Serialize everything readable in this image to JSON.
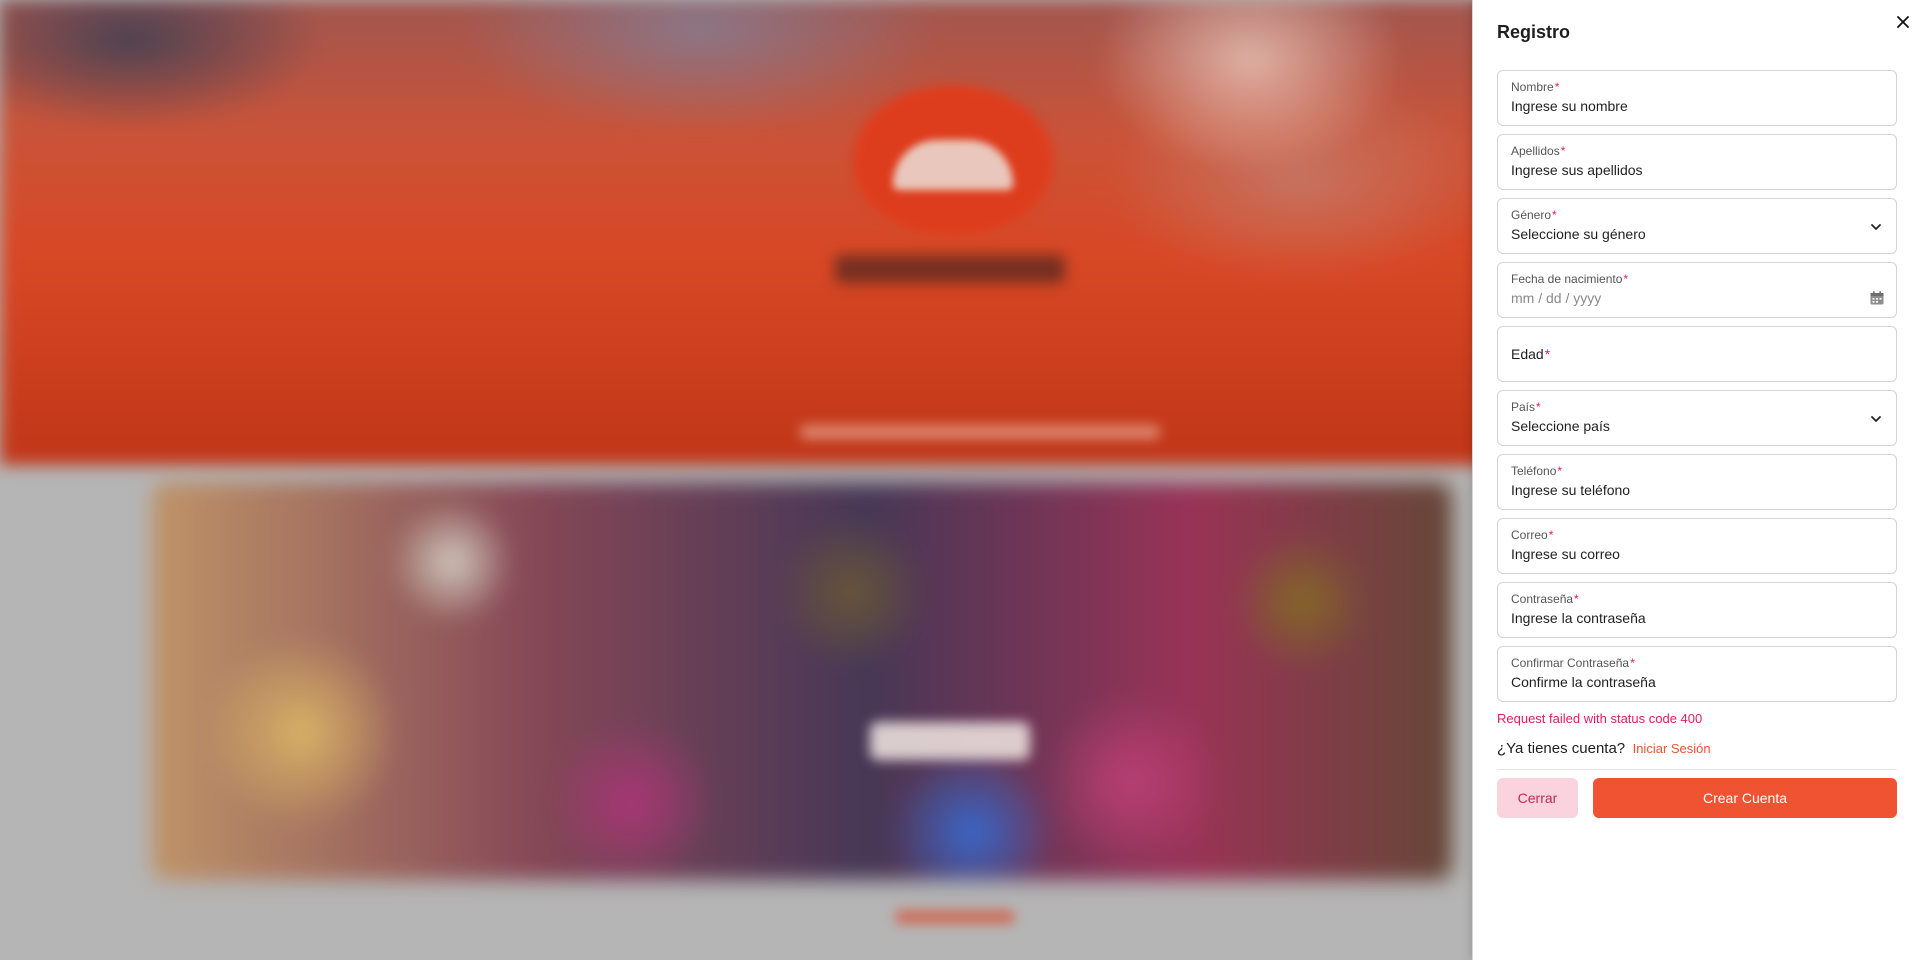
{
  "drawer": {
    "title": "Registro",
    "fields": [
      {
        "label": "Nombre",
        "value": "Ingrese su nombre",
        "required": "*"
      },
      {
        "label": "Apellidos",
        "value": "Ingrese sus apellidos",
        "required": "*"
      },
      {
        "label": "Género",
        "value": "Seleccione su género",
        "required": "*"
      },
      {
        "label": "Fecha de nacimiento",
        "value": "mm / dd / yyyy",
        "required": "*"
      },
      {
        "label": "Edad",
        "value": "",
        "required": "*"
      },
      {
        "label": "País",
        "value": "Seleccione país",
        "required": "*"
      },
      {
        "label": "Teléfono",
        "value": "Ingrese su teléfono",
        "required": "*"
      },
      {
        "label": "Correo",
        "value": "Ingrese su correo",
        "required": "*"
      },
      {
        "label": "Contraseña",
        "value": "Ingrese la contraseña",
        "required": "*"
      },
      {
        "label": "Confirmar Contraseña",
        "value": "Confirme la contraseña",
        "required": "*"
      }
    ],
    "error": "Request failed with status code 400",
    "login_question": "¿Ya tienes cuenta?",
    "login_link": "Iniciar Sesión",
    "close_button": "Cerrar",
    "create_button": "Crear Cuenta"
  },
  "icons": {
    "close": "close-icon",
    "select": "chevron-down-icon",
    "date": "calendar-icon"
  },
  "colors": {
    "accent": "#ef5332",
    "error": "#e31c5f",
    "secondary_button_bg": "#fbd3de",
    "secondary_button_text": "#c8285a"
  }
}
